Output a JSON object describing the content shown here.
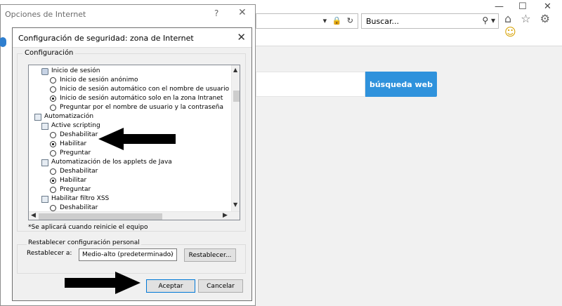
{
  "browser": {
    "search_text": "Buscar...",
    "web_search_button": "búsqueda web",
    "win_minimize": "—",
    "win_maximize": "☐",
    "win_close": "✕",
    "address_tools": "▾ 🔒 ↻",
    "search_icon": "⚲ ▾"
  },
  "outer_dialog": {
    "title": "Opciones de Internet",
    "help": "?",
    "close": "✕"
  },
  "dialog": {
    "title": "Configuración de seguridad: zona de Internet",
    "close": "✕",
    "settings_group_label": "Configuración",
    "note": "*Se aplicará cuando reinicie el equipo",
    "reset_group_label": "Restablecer configuración personal",
    "reset_to_label": "Restablecer a:",
    "reset_level": "Medio-alto (predeterminado)",
    "reset_button": "Restablecer...",
    "ok_button": "Aceptar",
    "cancel_button": "Cancelar"
  },
  "tree": {
    "items": [
      {
        "text": "Inicio de sesión",
        "kind": "user-icon",
        "indent": 1,
        "selected": false
      },
      {
        "text": "Inicio de sesión anónimo",
        "kind": "radio",
        "indent": 2,
        "selected": false
      },
      {
        "text": "Inicio de sesión automático con el nombre de usuario y c",
        "kind": "radio",
        "indent": 2,
        "selected": false
      },
      {
        "text": "Inicio de sesión automático solo en la zona Intranet",
        "kind": "radio",
        "indent": 2,
        "selected": true
      },
      {
        "text": "Preguntar por el nombre de usuario y la contraseña",
        "kind": "radio",
        "indent": 2,
        "selected": false
      },
      {
        "text": "Automatización",
        "kind": "folder-icon",
        "indent": 0,
        "selected": false
      },
      {
        "text": "Active scripting",
        "kind": "folder-icon",
        "indent": 1,
        "selected": false
      },
      {
        "text": "Deshabilitar",
        "kind": "radio",
        "indent": 2,
        "selected": false
      },
      {
        "text": "Habilitar",
        "kind": "radio",
        "indent": 2,
        "selected": true
      },
      {
        "text": "Preguntar",
        "kind": "radio",
        "indent": 2,
        "selected": false
      },
      {
        "text": "Automatización de los applets de Java",
        "kind": "folder-icon",
        "indent": 1,
        "selected": false
      },
      {
        "text": "Deshabilitar",
        "kind": "radio",
        "indent": 2,
        "selected": false
      },
      {
        "text": "Habilitar",
        "kind": "radio",
        "indent": 2,
        "selected": true
      },
      {
        "text": "Preguntar",
        "kind": "radio",
        "indent": 2,
        "selected": false
      },
      {
        "text": "Habilitar filtro XSS",
        "kind": "folder-icon",
        "indent": 1,
        "selected": false
      },
      {
        "text": "Deshabilitar",
        "kind": "radio",
        "indent": 2,
        "selected": false
      }
    ]
  },
  "icons": {
    "up": "▲",
    "down": "▼",
    "left": "◀",
    "right": "▶",
    "browser_right_icons": "⌂ ☆ ⚙",
    "smiley": "☺",
    "dropdown": "⌵"
  },
  "colors": {
    "accent_blue": "#2f92dc",
    "ok_border": "#0078d7"
  }
}
